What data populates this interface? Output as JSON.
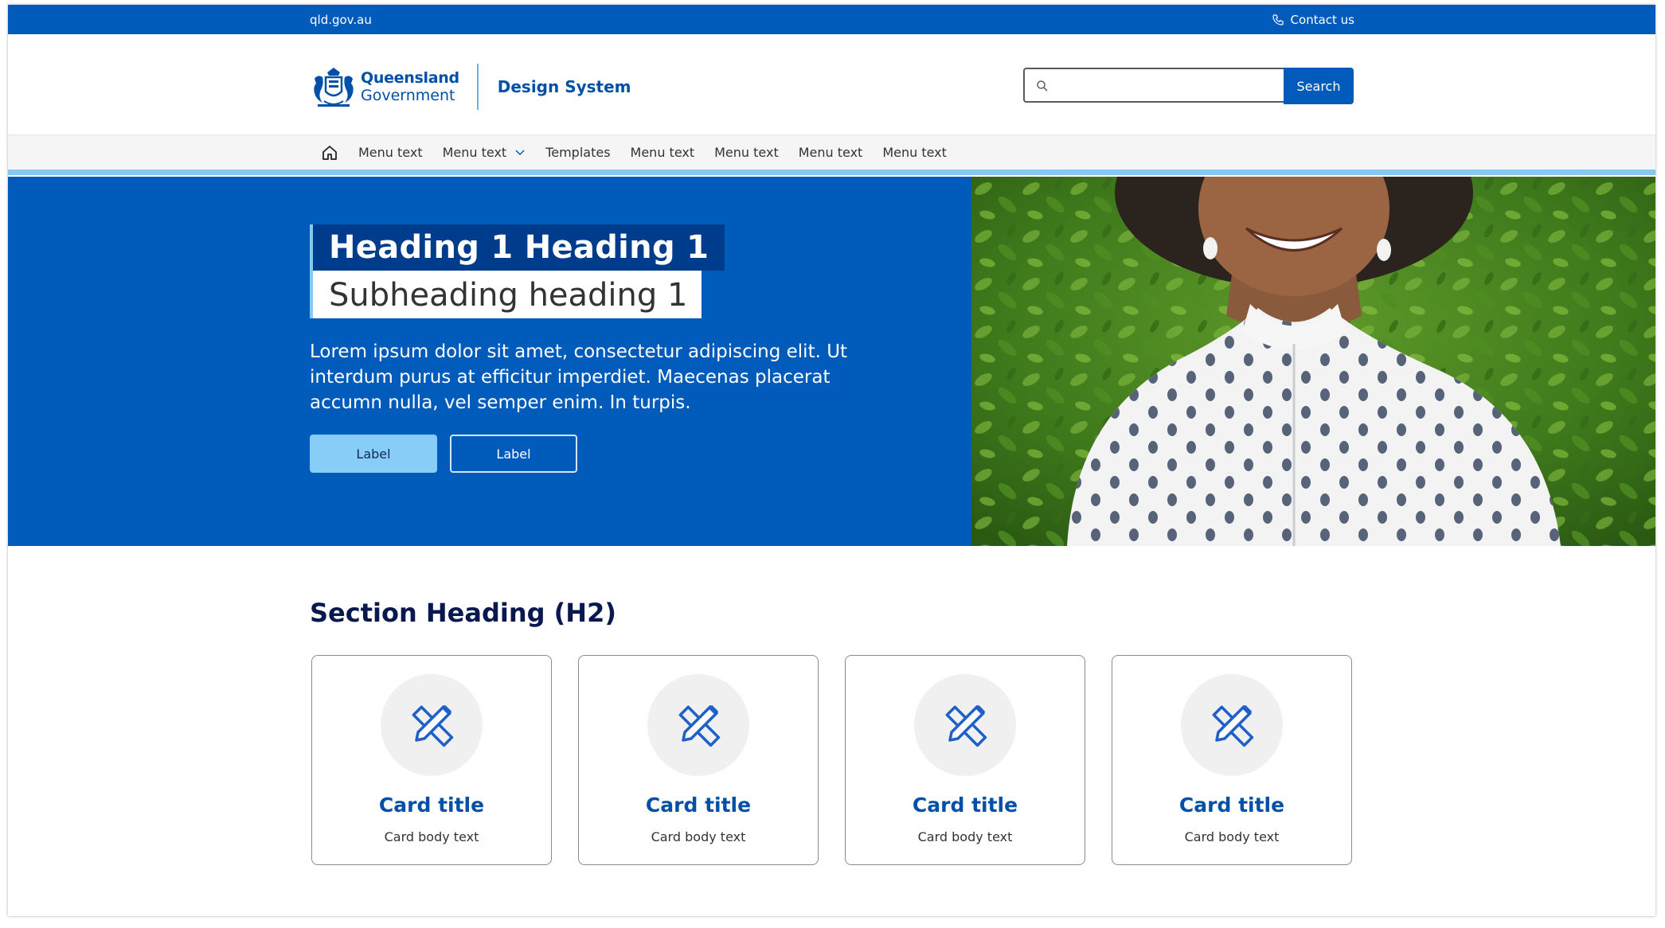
{
  "topbar": {
    "site": "qld.gov.au",
    "contact": "Contact us"
  },
  "header": {
    "logo_line1": "Queensland",
    "logo_line2": "Government",
    "site_name": "Design System",
    "search_button": "Search",
    "search_value": ""
  },
  "nav": {
    "items": [
      {
        "label": "Menu text"
      },
      {
        "label": "Menu text"
      },
      {
        "label": "Templates"
      },
      {
        "label": "Menu text"
      },
      {
        "label": "Menu text"
      },
      {
        "label": "Menu text"
      },
      {
        "label": "Menu text"
      }
    ]
  },
  "hero": {
    "heading": "Heading 1 Heading 1",
    "subheading": "Subheading heading 1",
    "body": "Lorem ipsum dolor sit amet, consectetur adipiscing elit. Ut interdum purus at efficitur imperdiet. Maecenas placerat accumn nulla, vel semper enim. In turpis.",
    "primary_button": "Label",
    "secondary_button": "Label"
  },
  "section": {
    "heading": "Section Heading (H2)",
    "cards": [
      {
        "title": "Card title",
        "body": "Card body text",
        "icon": "ruler-pencil-icon"
      },
      {
        "title": "Card title",
        "body": "Card body text",
        "icon": "ruler-pencil-icon"
      },
      {
        "title": "Card title",
        "body": "Card body text",
        "icon": "ruler-pencil-icon"
      },
      {
        "title": "Card title",
        "body": "Card body text",
        "icon": "ruler-pencil-icon"
      }
    ]
  },
  "colors": {
    "brand_blue": "#005bbb",
    "dark_blue": "#003c8c",
    "light_blue": "#88c8f0",
    "heading_navy": "#09194f"
  }
}
